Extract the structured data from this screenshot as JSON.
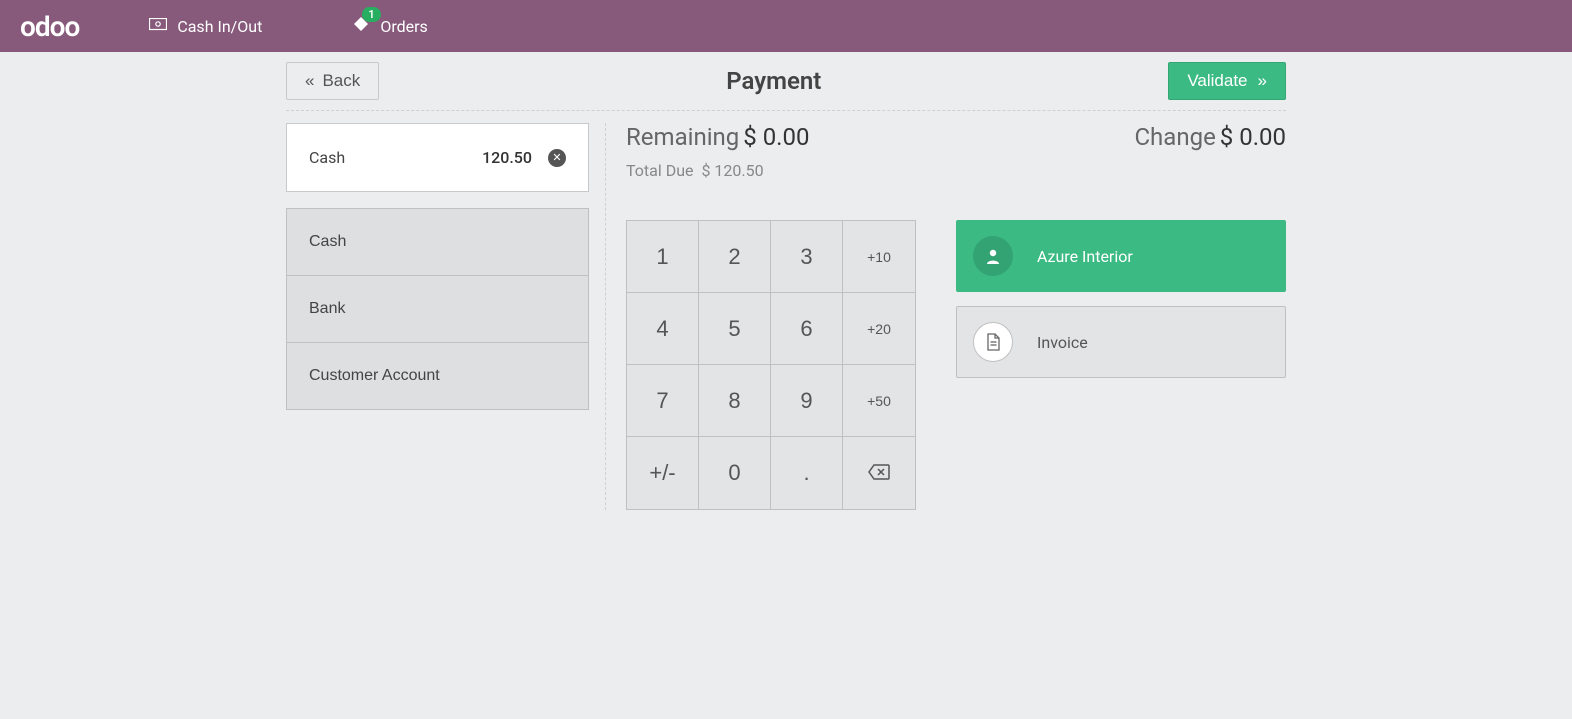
{
  "nav": {
    "logo": "odoo",
    "cash_in_out": "Cash In/Out",
    "orders": "Orders",
    "orders_badge": "1"
  },
  "header": {
    "back": "Back",
    "title": "Payment",
    "validate": "Validate"
  },
  "payment_line": {
    "method": "Cash",
    "amount": "120.50"
  },
  "methods": {
    "cash": "Cash",
    "bank": "Bank",
    "customer_account": "Customer Account"
  },
  "summary": {
    "remaining_label": "Remaining",
    "remaining_value": "$ 0.00",
    "total_due_label": "Total Due",
    "total_due_value": "$ 120.50",
    "change_label": "Change",
    "change_value": "$ 0.00"
  },
  "numpad": {
    "1": "1",
    "2": "2",
    "3": "3",
    "p10": "+10",
    "4": "4",
    "5": "5",
    "6": "6",
    "p20": "+20",
    "7": "7",
    "8": "8",
    "9": "9",
    "p50": "+50",
    "sign": "+/-",
    "0": "0",
    "dot": "."
  },
  "side": {
    "customer": "Azure Interior",
    "invoice": "Invoice"
  }
}
